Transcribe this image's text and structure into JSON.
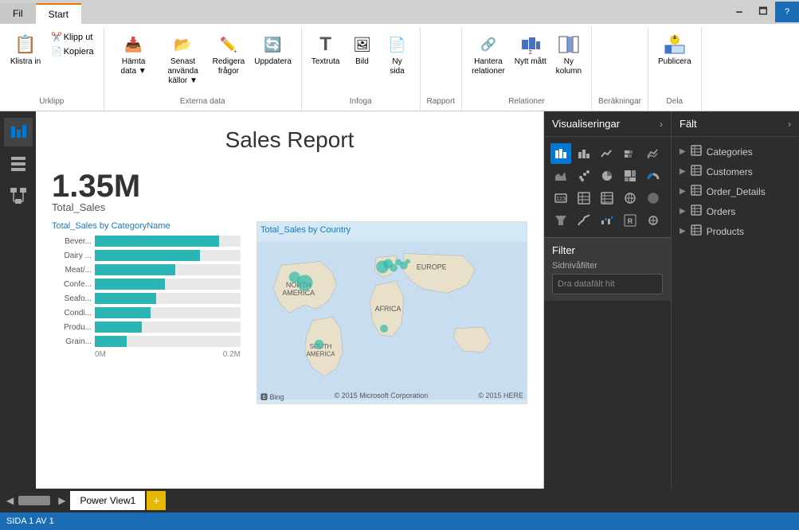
{
  "window": {
    "tab_fil": "Fil",
    "tab_start": "Start"
  },
  "ribbon": {
    "groups": [
      {
        "label": "Urklipp",
        "items": [
          {
            "label": "Klistra in",
            "icon": "📋"
          },
          {
            "label": "Klipp ut",
            "icon": "✂️"
          },
          {
            "label": "Kopiera",
            "icon": "📄"
          }
        ]
      },
      {
        "label": "Externa data",
        "items": [
          {
            "label": "Hämta data ▼",
            "icon": "📥"
          },
          {
            "label": "Senast\nanvända källor ▼",
            "icon": "📂"
          },
          {
            "label": "Redigera\nfrågor",
            "icon": "✏️"
          },
          {
            "label": "Uppdatera",
            "icon": "🔄"
          }
        ]
      },
      {
        "label": "Infoga",
        "items": [
          {
            "label": "Textruta",
            "icon": "T"
          },
          {
            "label": "Bild",
            "icon": "🖼"
          },
          {
            "label": "Ny\nsida",
            "icon": "📄"
          }
        ]
      },
      {
        "label": "Rapport",
        "items": []
      },
      {
        "label": "Relationer",
        "items": [
          {
            "label": "Hantera\nrelationer",
            "icon": "🔗"
          },
          {
            "label": "Nytt\nmått",
            "icon": "📊"
          },
          {
            "label": "Ny\nkolumn",
            "icon": "📊"
          }
        ]
      },
      {
        "label": "Beräkningar",
        "items": []
      },
      {
        "label": "Dela",
        "items": [
          {
            "label": "Publicera",
            "icon": "📤"
          }
        ]
      }
    ]
  },
  "canvas": {
    "title": "Sales Report",
    "metric_value": "1.35M",
    "metric_label": "Total_Sales",
    "bar_chart_title": "Total_Sales by CategoryName",
    "map_title": "Total_Sales by Country",
    "bars": [
      {
        "label": "Bever...",
        "pct": 85
      },
      {
        "label": "Dairy ...",
        "pct": 72
      },
      {
        "label": "Meat/...",
        "pct": 55
      },
      {
        "label": "Confe...",
        "pct": 48
      },
      {
        "label": "Seafo...",
        "pct": 42
      },
      {
        "label": "Condi...",
        "pct": 38
      },
      {
        "label": "Produ...",
        "pct": 32
      },
      {
        "label": "Grain...",
        "pct": 22
      }
    ],
    "bar_axis_start": "0M",
    "bar_axis_end": "0.2M",
    "map_footer_left": "Bing",
    "map_footer_copy1": "© 2015 Microsoft Corporation",
    "map_footer_copy2": "© 2015 HERE"
  },
  "visualizations": {
    "header": "Visualiseringar",
    "icons": [
      "bar",
      "column",
      "line",
      "bar-stacked",
      "line2",
      "scatter",
      "pie",
      "donut",
      "area",
      "area2",
      "combo",
      "ribbon",
      "waterfall",
      "funnel",
      "gauge",
      "card",
      "table",
      "matrix",
      "map",
      "filled-map",
      "treemap",
      "r-visual",
      "py-visual",
      "custom"
    ]
  },
  "fields": {
    "header": "Fält",
    "items": [
      {
        "name": "Categories",
        "icon": "table"
      },
      {
        "name": "Customers",
        "icon": "table"
      },
      {
        "name": "Order_Details",
        "icon": "table"
      },
      {
        "name": "Orders",
        "icon": "table"
      },
      {
        "name": "Products",
        "icon": "table"
      }
    ]
  },
  "filter": {
    "header": "Filter",
    "sidniva_label": "Sidnivåfilter",
    "drop_label": "Dra datafält hit"
  },
  "bottom": {
    "tab_name": "Power View1",
    "add_label": "+",
    "scroll_left": "◀",
    "scroll_right": "▶"
  },
  "status": {
    "text": "SIDA 1 AV 1"
  }
}
